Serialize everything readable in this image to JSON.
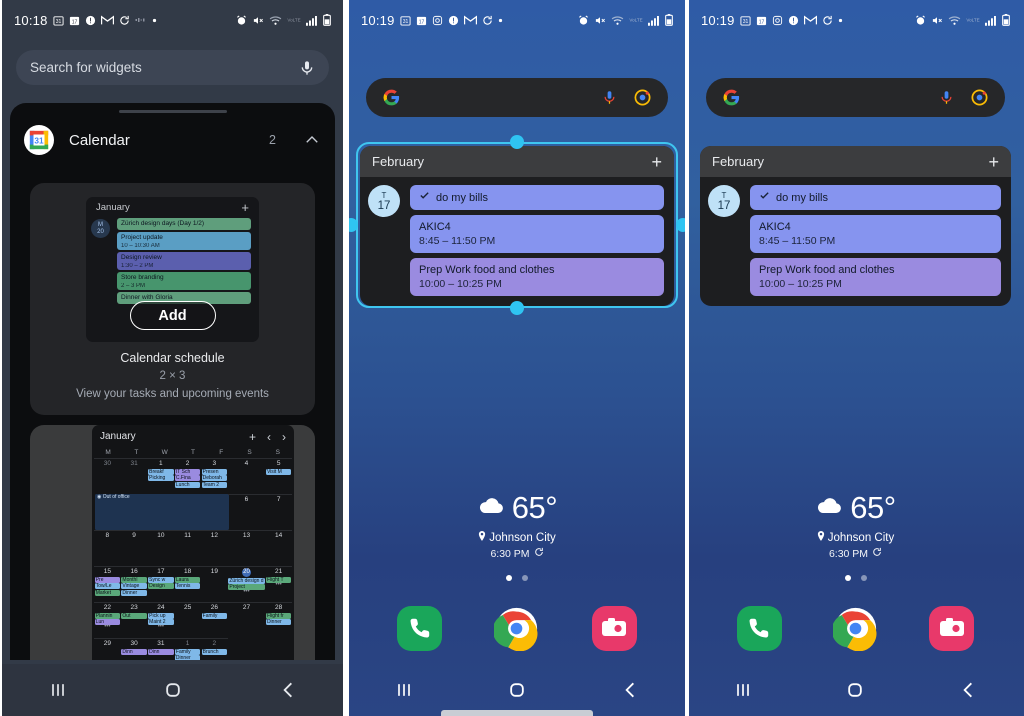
{
  "panels": {
    "widget_picker": {
      "status": {
        "time": "10:18",
        "icons": [
          "calendar-31-icon",
          "calendar-17-icon",
          "info-icon",
          "gmail-icon",
          "sync-icon",
          "audio-icon",
          "dot-icon"
        ],
        "right_icons": [
          "alarm-icon",
          "mute-icon",
          "wifi-icon",
          "volte-icon",
          "signal-icon",
          "battery-icon"
        ]
      },
      "search": {
        "placeholder": "Search for widgets",
        "mic": "mic-icon"
      },
      "app_row": {
        "name": "Calendar",
        "count": "2",
        "icon": "google-calendar-icon",
        "collapse": "chevron-up-icon"
      },
      "widget_card": {
        "title": "Calendar schedule",
        "size": "2 × 3",
        "description": "View your tasks and upcoming events",
        "add_label": "Add",
        "preview": {
          "month": "January",
          "plus": "+",
          "day_weekday": "M",
          "day_number": "20",
          "events": [
            {
              "title": "Zürich design days (Day 1/2)",
              "time": "",
              "color": "#5f9e7c"
            },
            {
              "title": "Project update",
              "time": "10 – 10:30 AM",
              "color": "#5a9ec4"
            },
            {
              "title": "Design review",
              "time": "1:30 – 2 PM",
              "color": "#5b5fae"
            },
            {
              "title": "Store branding",
              "time": "2 – 3 PM",
              "color": "#47956d"
            },
            {
              "title": "Dinner with Gloria",
              "time": "",
              "color": "#5f9e7c"
            }
          ]
        }
      },
      "month_widget": {
        "month": "January",
        "plus": "+",
        "prev": "‹",
        "next": "›",
        "dow": [
          "M",
          "T",
          "W",
          "T",
          "F",
          "S",
          "S"
        ],
        "weeks": [
          [
            {
              "num": "30",
              "dim": true,
              "events": []
            },
            {
              "num": "31",
              "dim": true,
              "events": []
            },
            {
              "num": "1",
              "dim": false,
              "events": [
                {
                  "t": "Breakf",
                  "c": "#7fb8e8"
                },
                {
                  "t": "Picking",
                  "c": "#7fb8e8"
                }
              ]
            },
            {
              "num": "2",
              "dim": false,
              "events": [
                {
                  "t": "IT Sch",
                  "c": "#9a8be0"
                },
                {
                  "t": "C.Fina",
                  "c": "#9a8be0"
                },
                {
                  "t": "Lunch",
                  "c": "#7fb8e8"
                }
              ]
            },
            {
              "num": "3",
              "dim": false,
              "events": [
                {
                  "t": "Presen",
                  "c": "#7fb8e8"
                },
                {
                  "t": "Deborah",
                  "c": "#7fb8e8"
                },
                {
                  "t": "Team 2",
                  "c": "#7fb8e8"
                }
              ]
            },
            {
              "num": "4",
              "dim": false,
              "events": []
            },
            {
              "num": "5",
              "dim": false,
              "events": [
                {
                  "t": "Visit M",
                  "c": "#7fb8e8"
                }
              ]
            }
          ],
          [
            {
              "num": "6",
              "dim": false,
              "events": []
            },
            {
              "num": "7",
              "dim": false,
              "events": []
            },
            {
              "num": "8",
              "dim": false,
              "events": []
            },
            {
              "num": "9",
              "dim": false,
              "events": []
            },
            {
              "num": "10",
              "dim": false,
              "events": []
            },
            {
              "num": "11",
              "dim": false,
              "events": []
            },
            {
              "num": "12",
              "dim": false,
              "events": []
            }
          ],
          [
            {
              "num": "13",
              "dim": false,
              "events": []
            },
            {
              "num": "14",
              "dim": false,
              "events": []
            },
            {
              "num": "15",
              "dim": false,
              "events": [
                {
                  "t": "Pre",
                  "c": "#9a8be0"
                },
                {
                  "t": "Tow/Le",
                  "c": "#7fb8e8"
                },
                {
                  "t": "Market",
                  "c": "#5aa87a"
                }
              ]
            },
            {
              "num": "16",
              "dim": false,
              "events": [
                {
                  "t": "Monthl",
                  "c": "#5aa87a"
                },
                {
                  "t": "Vintage",
                  "c": "#7fb8e8"
                },
                {
                  "t": "Dinner",
                  "c": "#7fb8e8"
                }
              ]
            },
            {
              "num": "17",
              "dim": false,
              "events": [
                {
                  "t": "Sync w",
                  "c": "#7fb8e8"
                },
                {
                  "t": "Design",
                  "c": "#5aa87a"
                }
              ]
            },
            {
              "num": "18",
              "dim": false,
              "events": [
                {
                  "t": "Laura",
                  "c": "#5aa87a"
                },
                {
                  "t": "Tennis",
                  "c": "#7fb8e8"
                }
              ]
            },
            {
              "num": "19",
              "dim": false,
              "events": []
            }
          ],
          [
            {
              "num": "20",
              "dim": false,
              "today": true,
              "events": [
                {
                  "t": "Zürich design d",
                  "c": "#7fb8e8"
                },
                {
                  "t": "Project",
                  "c": "#5aa87a"
                }
              ],
              "more": true
            },
            {
              "num": "21",
              "dim": false,
              "events": [
                {
                  "t": "Flight T",
                  "c": "#5aa87a"
                }
              ],
              "more": true
            },
            {
              "num": "22",
              "dim": false,
              "events": [
                {
                  "t": "Plannin",
                  "c": "#5aa87a"
                },
                {
                  "t": "Lun",
                  "c": "#9a8be0"
                }
              ],
              "more": true
            },
            {
              "num": "23",
              "dim": false,
              "events": [
                {
                  "t": "Out",
                  "c": "#5aa87a"
                }
              ]
            },
            {
              "num": "24",
              "dim": false,
              "events": [
                {
                  "t": "Pick up",
                  "c": "#7fb8e8"
                },
                {
                  "t": "Maint 2",
                  "c": "#7fb8e8"
                }
              ],
              "more": true
            },
            {
              "num": "25",
              "dim": false,
              "events": []
            },
            {
              "num": "26",
              "dim": false,
              "events": [
                {
                  "t": "Family",
                  "c": "#7fb8e8"
                }
              ]
            }
          ],
          [
            {
              "num": "27",
              "dim": false,
              "events": []
            },
            {
              "num": "28",
              "dim": false,
              "events": [
                {
                  "t": "Flight fr",
                  "c": "#5aa87a"
                },
                {
                  "t": "Dinner",
                  "c": "#7fb8e8"
                }
              ]
            },
            {
              "num": "29",
              "dim": false,
              "events": []
            },
            {
              "num": "30",
              "dim": false,
              "events": [
                {
                  "t": "Dinn",
                  "c": "#9a8be0"
                }
              ]
            },
            {
              "num": "31",
              "dim": false,
              "events": [
                {
                  "t": "Dinn",
                  "c": "#9a8be0"
                }
              ]
            },
            {
              "num": "1",
              "dim": true,
              "events": [
                {
                  "t": "Family",
                  "c": "#7fb8e8"
                },
                {
                  "t": "Dinner",
                  "c": "#7fb8e8"
                }
              ]
            },
            {
              "num": "2",
              "dim": true,
              "events": [
                {
                  "t": "Brunch",
                  "c": "#7fb8e8"
                }
              ]
            }
          ]
        ],
        "out_of_office": "Out of office"
      },
      "navbar": {
        "recents": "recents-icon",
        "home": "home-icon",
        "back": "back-icon"
      }
    },
    "home_selected": {
      "status": {
        "time": "10:19"
      },
      "google_search": {
        "logo": "google-g-icon",
        "mic": "google-mic-icon",
        "lens": "google-lens-icon"
      },
      "calendar_widget": {
        "month": "February",
        "plus": "+",
        "day_weekday": "T",
        "day_number": "17",
        "events": [
          {
            "title": "do my bills",
            "time": "",
            "icon": "task-icon",
            "color": "#8694ef"
          },
          {
            "title": "AKIC4",
            "time": "8:45 – 11:50 PM",
            "icon": "",
            "color": "#8694ef"
          },
          {
            "title": "Prep Work food and clothes",
            "time": "10:00 – 10:25 PM",
            "icon": "",
            "color": "#9a8be0"
          }
        ],
        "selected": true
      },
      "weather": {
        "temp": "65°",
        "icon": "cloud-icon",
        "city": "Johnson City",
        "time": "6:30 PM",
        "refresh": "refresh-icon",
        "pin": "location-pin-icon"
      },
      "page_dots": {
        "count": 2,
        "active_index": 0
      },
      "dock": [
        {
          "name": "phone",
          "icon": "phone-icon"
        },
        {
          "name": "chrome",
          "icon": "chrome-icon"
        },
        {
          "name": "camera",
          "icon": "camera-icon"
        }
      ],
      "navbar": {
        "recents": "recents-icon",
        "home": "home-icon",
        "back": "back-icon"
      }
    },
    "home_placed": {
      "status": {
        "time": "10:19"
      },
      "google_search": {
        "logo": "google-g-icon",
        "mic": "google-mic-icon",
        "lens": "google-lens-icon"
      },
      "calendar_widget": {
        "month": "February",
        "plus": "+",
        "day_weekday": "T",
        "day_number": "17",
        "events": [
          {
            "title": "do my bills",
            "time": "",
            "icon": "task-icon",
            "color": "#8694ef"
          },
          {
            "title": "AKIC4",
            "time": "8:45 – 11:50 PM",
            "icon": "",
            "color": "#8694ef"
          },
          {
            "title": "Prep Work food and clothes",
            "time": "10:00 – 10:25 PM",
            "icon": "",
            "color": "#9a8be0"
          }
        ],
        "selected": false
      },
      "weather": {
        "temp": "65°",
        "icon": "cloud-icon",
        "city": "Johnson City",
        "time": "6:30 PM",
        "refresh": "refresh-icon",
        "pin": "location-pin-icon"
      },
      "page_dots": {
        "count": 2,
        "active_index": 0
      },
      "dock": [
        {
          "name": "phone",
          "icon": "phone-icon"
        },
        {
          "name": "chrome",
          "icon": "chrome-icon"
        },
        {
          "name": "camera",
          "icon": "camera-icon"
        }
      ],
      "navbar": {
        "recents": "recents-icon",
        "home": "home-icon",
        "back": "back-icon"
      }
    }
  },
  "colors": {
    "accent_selection": "#3fc6f0",
    "home_bg_top": "#2f5ba6",
    "home_bg_bottom": "#27407f",
    "sheet_bg": "#0c0d0f",
    "picker_bg": "#323a47"
  }
}
